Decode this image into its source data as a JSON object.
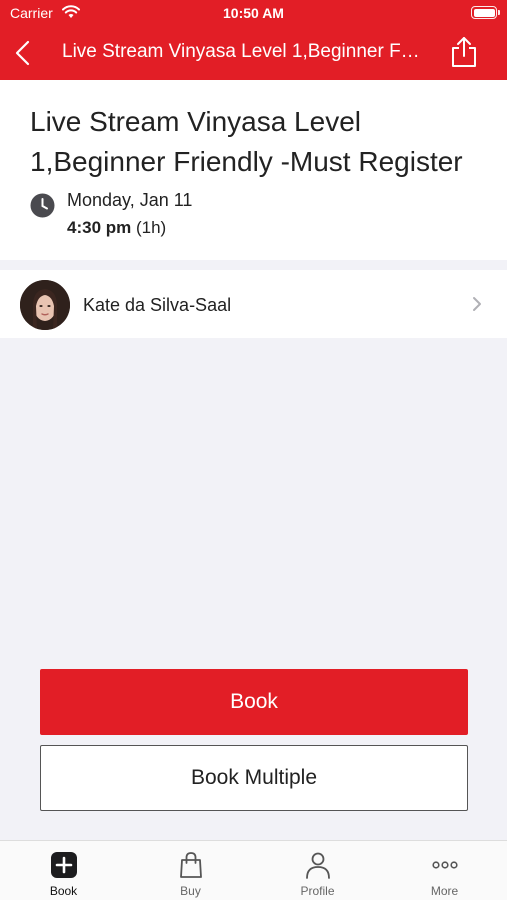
{
  "status_bar": {
    "carrier": "Carrier",
    "time": "10:50 AM"
  },
  "nav": {
    "title": "Live Stream Vinyasa  Level 1,Beginner Friendly -Must Register"
  },
  "class": {
    "title_line1": "Live Stream Vinyasa  Level",
    "title_line2": "1,Beginner Friendly -Must Register",
    "date": "Monday, Jan 11",
    "time": "4:30 pm",
    "duration": "(1h)"
  },
  "instructor": {
    "name": "Kate da Silva-Saal"
  },
  "actions": {
    "book_label": "Book",
    "book_multiple_label": "Book Multiple"
  },
  "tabs": [
    {
      "label": "Book",
      "icon": "plus-square-icon",
      "active": true
    },
    {
      "label": "Buy",
      "icon": "shopping-bag-icon",
      "active": false
    },
    {
      "label": "Profile",
      "icon": "person-icon",
      "active": false
    },
    {
      "label": "More",
      "icon": "ellipsis-icon",
      "active": false
    }
  ],
  "colors": {
    "brand_red": "#e21e26",
    "background": "#f2f2f7"
  }
}
